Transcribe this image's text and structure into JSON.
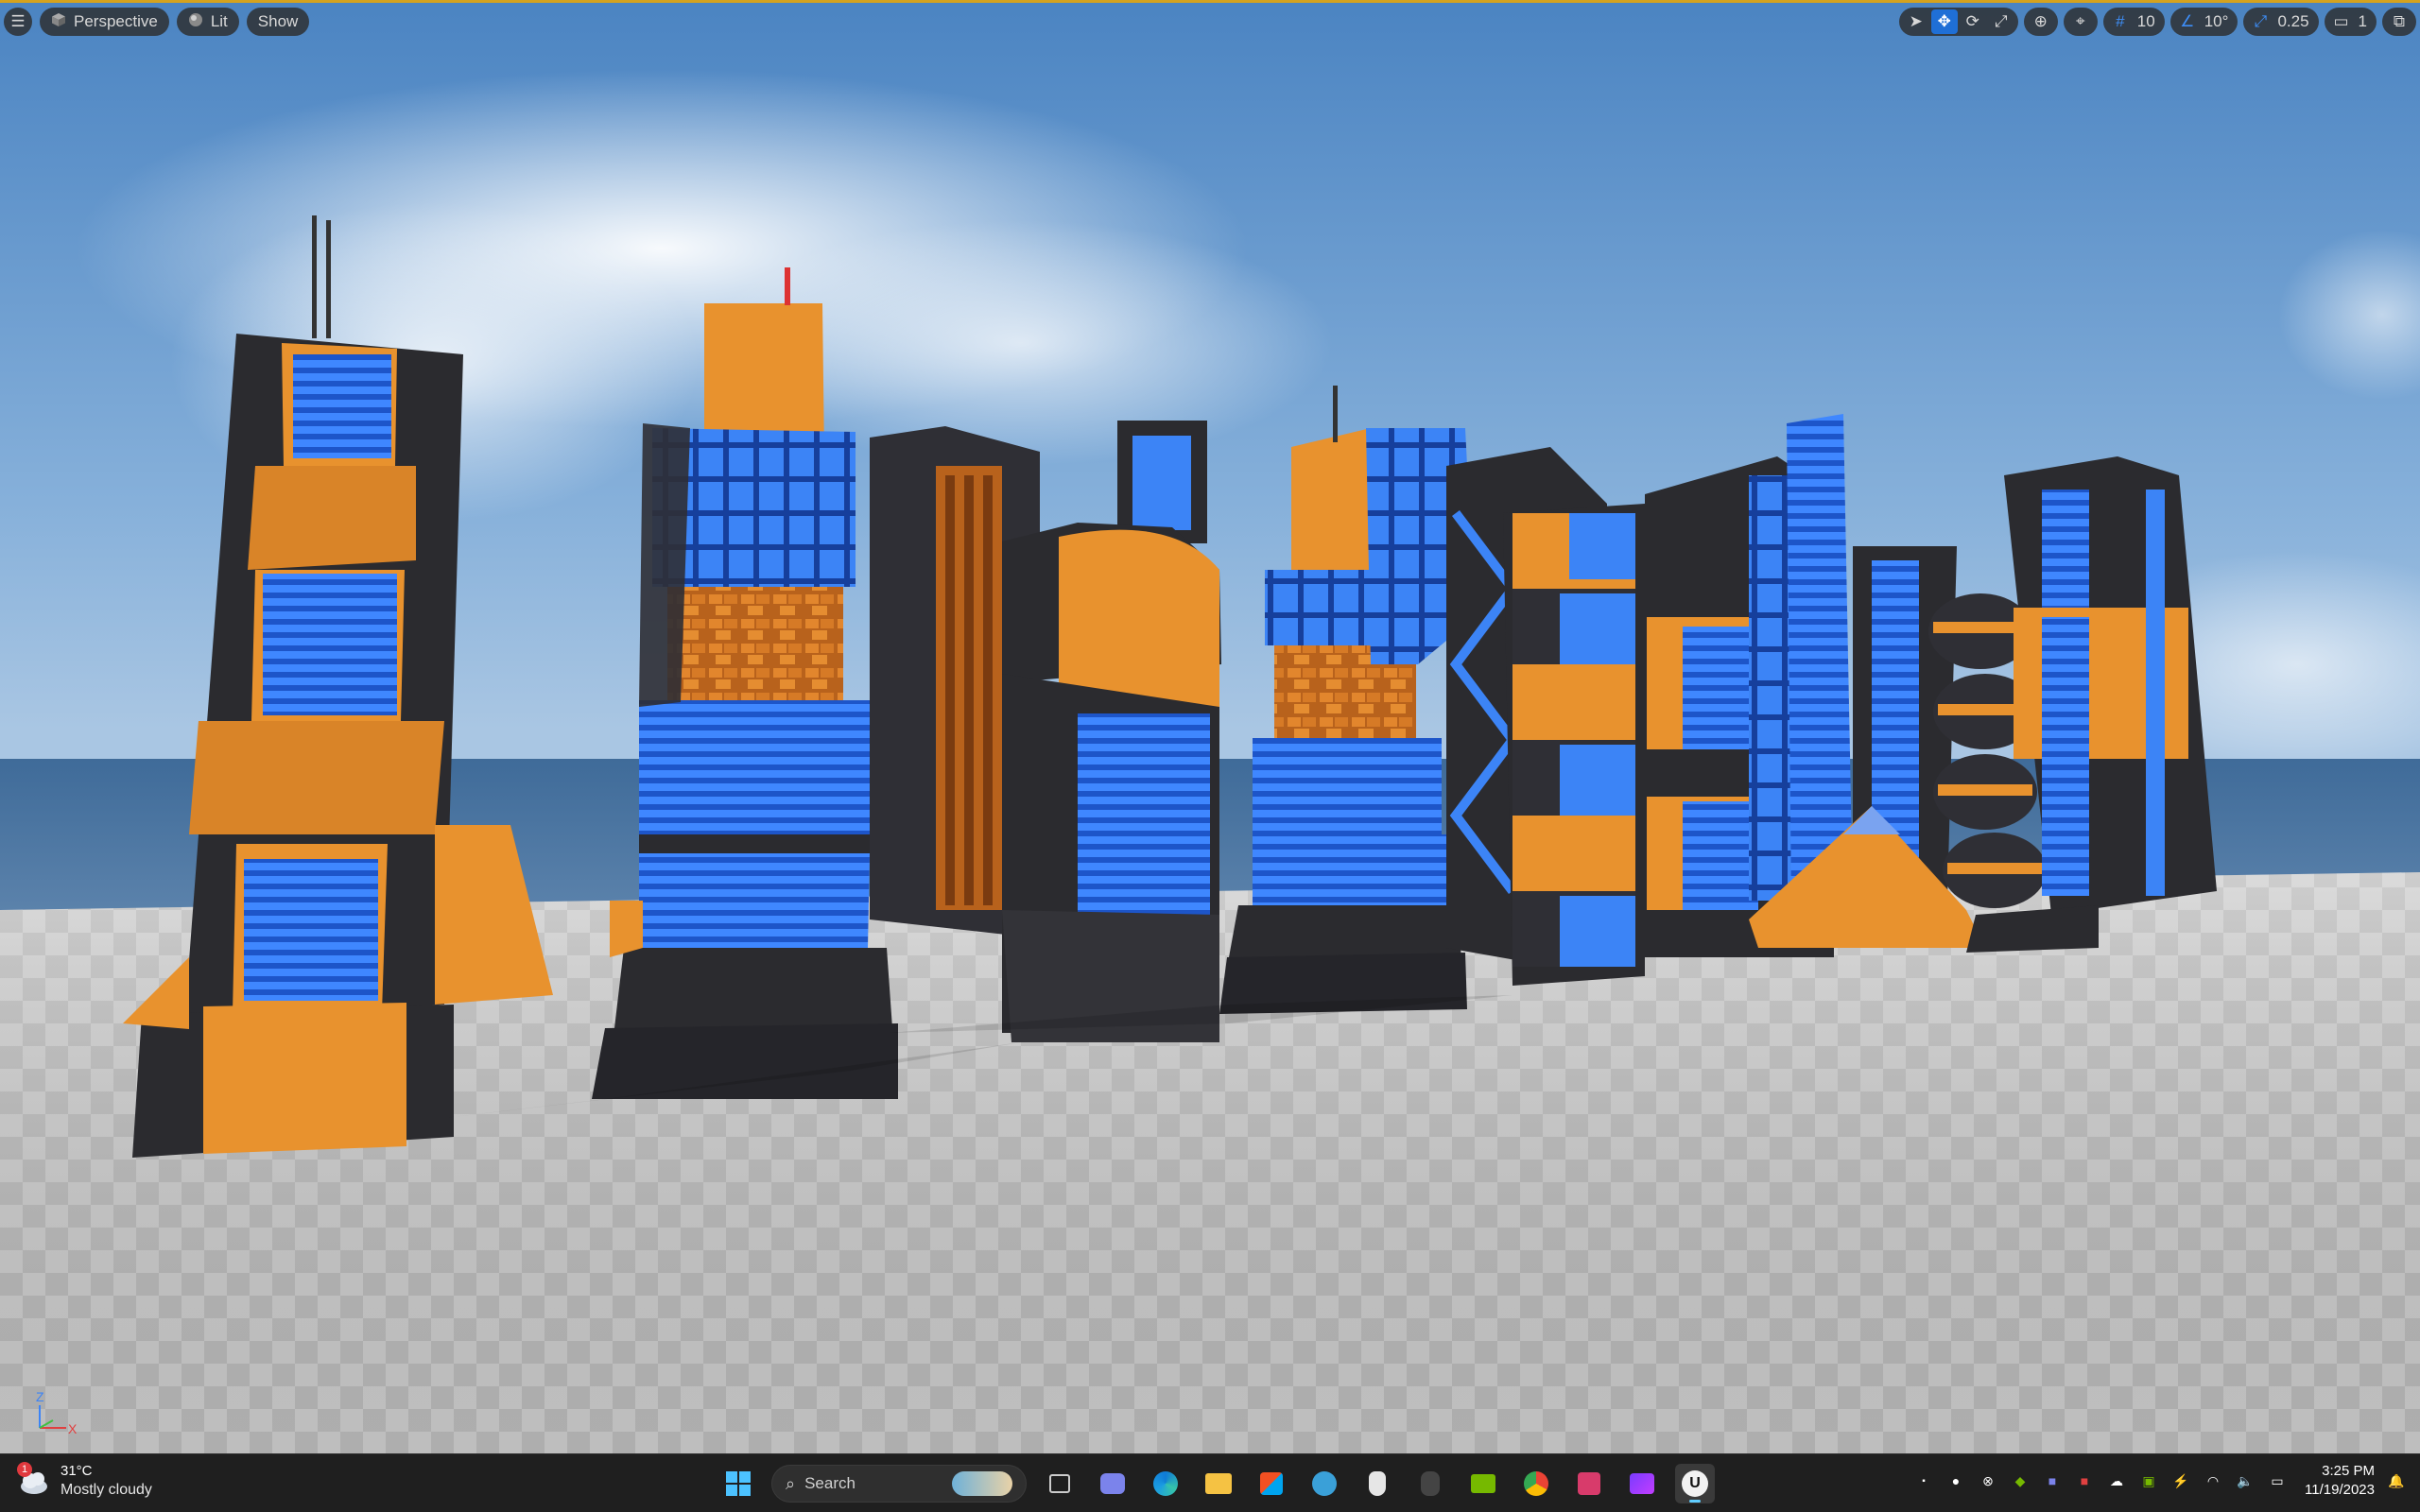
{
  "viewport": {
    "menu_icon": "hamburger-icon",
    "perspective_label": "Perspective",
    "lit_label": "Lit",
    "show_label": "Show",
    "grid_snap_value": "10",
    "rotation_snap_value": "10°",
    "scale_snap_value": "0.25",
    "camera_speed_value": "1"
  },
  "axis_gizmo": {
    "z": "Z",
    "x": "X"
  },
  "taskbar": {
    "weather_badge": "1",
    "temperature": "31°C",
    "condition": "Mostly cloudy",
    "search_placeholder": "Search",
    "time": "3:25 PM",
    "date": "11/19/2023"
  },
  "colors": {
    "accent": "#d5a21e",
    "active_tool": "#1f6fd6",
    "building_orange": "#e8922e",
    "building_blue": "#2f6ee8",
    "building_dark": "#2b2b2f"
  }
}
